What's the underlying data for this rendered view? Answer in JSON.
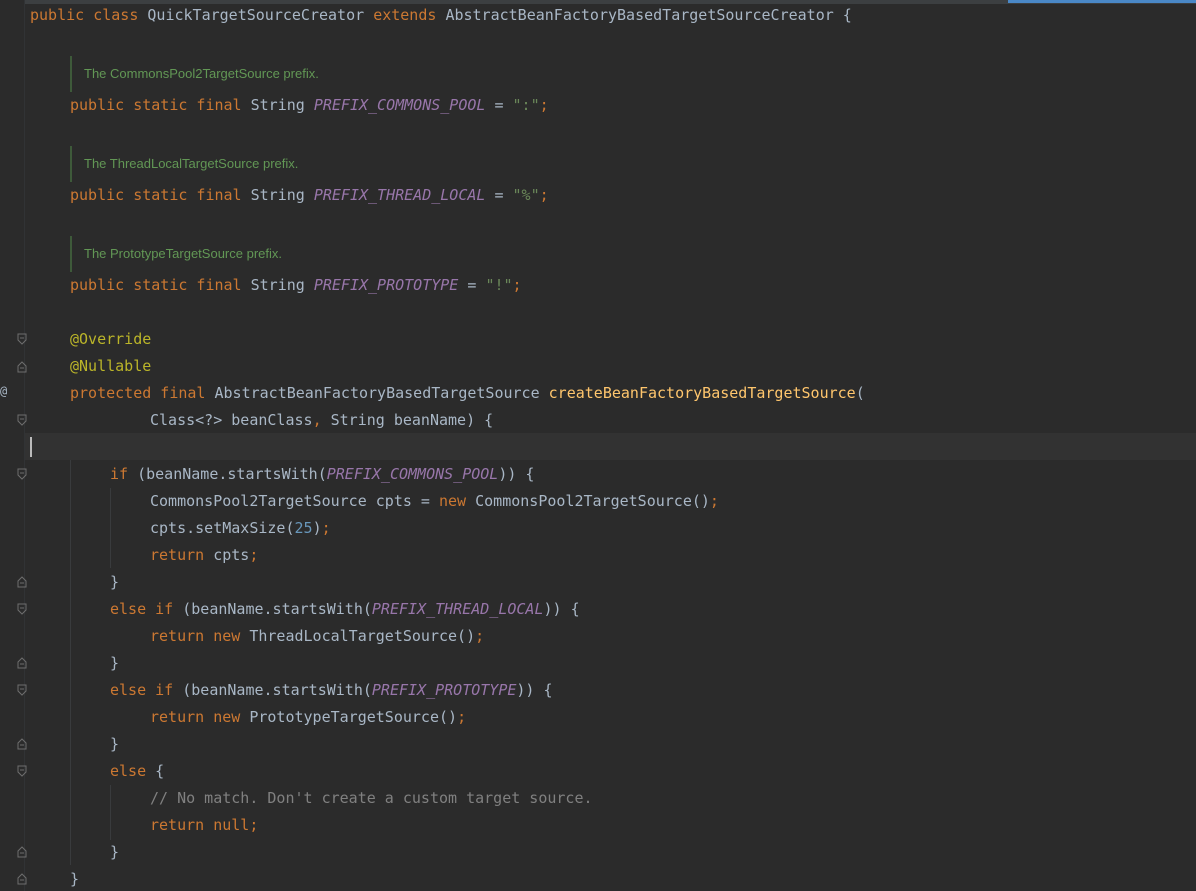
{
  "editor": {
    "annotation_gutter_glyph": "@",
    "lines": [
      {
        "id": "class-decl",
        "tokens": [
          {
            "t": "public class ",
            "c": "kw"
          },
          {
            "t": "QuickTargetSourceCreator ",
            "c": "plain"
          },
          {
            "t": "extends ",
            "c": "kw"
          },
          {
            "t": "AbstractBeanFactoryBasedTargetSourceCreator {",
            "c": "plain"
          }
        ]
      },
      {
        "id": "field-commons-pool",
        "tokens": [
          {
            "t": "public static final ",
            "c": "kw"
          },
          {
            "t": "String ",
            "c": "plain"
          },
          {
            "t": "PREFIX_COMMONS_POOL",
            "c": "const"
          },
          {
            "t": " = ",
            "c": "plain"
          },
          {
            "t": "\":\"",
            "c": "str"
          },
          {
            "t": ";",
            "c": "kw"
          }
        ]
      },
      {
        "id": "field-thread-local",
        "tokens": [
          {
            "t": "public static final ",
            "c": "kw"
          },
          {
            "t": "String ",
            "c": "plain"
          },
          {
            "t": "PREFIX_THREAD_LOCAL",
            "c": "const"
          },
          {
            "t": " = ",
            "c": "plain"
          },
          {
            "t": "\"%\"",
            "c": "str"
          },
          {
            "t": ";",
            "c": "kw"
          }
        ]
      },
      {
        "id": "field-prototype",
        "tokens": [
          {
            "t": "public static final ",
            "c": "kw"
          },
          {
            "t": "String ",
            "c": "plain"
          },
          {
            "t": "PREFIX_PROTOTYPE",
            "c": "const"
          },
          {
            "t": " = ",
            "c": "plain"
          },
          {
            "t": "\"!\"",
            "c": "str"
          },
          {
            "t": ";",
            "c": "kw"
          }
        ]
      },
      {
        "id": "override",
        "tokens": [
          {
            "t": "@Override",
            "c": "ann"
          }
        ]
      },
      {
        "id": "nullable",
        "tokens": [
          {
            "t": "@Nullable",
            "c": "ann"
          }
        ]
      },
      {
        "id": "method-sig",
        "tokens": [
          {
            "t": "protected final ",
            "c": "kw"
          },
          {
            "t": "AbstractBeanFactoryBasedTargetSource ",
            "c": "plain"
          },
          {
            "t": "createBeanFactoryBasedTargetSource",
            "c": "fn"
          },
          {
            "t": "(",
            "c": "plain"
          }
        ]
      },
      {
        "id": "method-params",
        "tokens": [
          {
            "t": "Class<?> beanClass",
            "c": "plain"
          },
          {
            "t": ", ",
            "c": "kw"
          },
          {
            "t": "String beanName) {",
            "c": "plain"
          }
        ]
      },
      {
        "id": "if-commons",
        "tokens": [
          {
            "t": "if ",
            "c": "kw"
          },
          {
            "t": "(beanName.startsWith(",
            "c": "plain"
          },
          {
            "t": "PREFIX_COMMONS_POOL",
            "c": "const"
          },
          {
            "t": ")) {",
            "c": "plain"
          }
        ]
      },
      {
        "id": "new-cpts",
        "tokens": [
          {
            "t": "CommonsPool2TargetSource cpts = ",
            "c": "plain"
          },
          {
            "t": "new ",
            "c": "kw"
          },
          {
            "t": "CommonsPool2TargetSource()",
            "c": "plain"
          },
          {
            "t": ";",
            "c": "kw"
          }
        ]
      },
      {
        "id": "set-max-size",
        "tokens": [
          {
            "t": "cpts.setMaxSize(",
            "c": "plain"
          },
          {
            "t": "25",
            "c": "num"
          },
          {
            "t": ")",
            "c": "plain"
          },
          {
            "t": ";",
            "c": "kw"
          }
        ]
      },
      {
        "id": "return-cpts",
        "tokens": [
          {
            "t": "return ",
            "c": "kw"
          },
          {
            "t": "cpts",
            "c": "plain"
          },
          {
            "t": ";",
            "c": "kw"
          }
        ]
      },
      {
        "id": "close-1",
        "tokens": [
          {
            "t": "}",
            "c": "plain"
          }
        ]
      },
      {
        "id": "elseif-thread",
        "tokens": [
          {
            "t": "else if ",
            "c": "kw"
          },
          {
            "t": "(beanName.startsWith(",
            "c": "plain"
          },
          {
            "t": "PREFIX_THREAD_LOCAL",
            "c": "const"
          },
          {
            "t": ")) {",
            "c": "plain"
          }
        ]
      },
      {
        "id": "return-thread",
        "tokens": [
          {
            "t": "return new ",
            "c": "kw"
          },
          {
            "t": "ThreadLocalTargetSource()",
            "c": "plain"
          },
          {
            "t": ";",
            "c": "kw"
          }
        ]
      },
      {
        "id": "close-2",
        "tokens": [
          {
            "t": "}",
            "c": "plain"
          }
        ]
      },
      {
        "id": "elseif-proto",
        "tokens": [
          {
            "t": "else if ",
            "c": "kw"
          },
          {
            "t": "(beanName.startsWith(",
            "c": "plain"
          },
          {
            "t": "PREFIX_PROTOTYPE",
            "c": "const"
          },
          {
            "t": ")) {",
            "c": "plain"
          }
        ]
      },
      {
        "id": "return-proto",
        "tokens": [
          {
            "t": "return new ",
            "c": "kw"
          },
          {
            "t": "PrototypeTargetSource()",
            "c": "plain"
          },
          {
            "t": ";",
            "c": "kw"
          }
        ]
      },
      {
        "id": "close-3",
        "tokens": [
          {
            "t": "}",
            "c": "plain"
          }
        ]
      },
      {
        "id": "else",
        "tokens": [
          {
            "t": "else ",
            "c": "kw"
          },
          {
            "t": "{",
            "c": "plain"
          }
        ]
      },
      {
        "id": "comment-no-match",
        "tokens": [
          {
            "t": "// No match. Don't create a custom target source.",
            "c": "cmt"
          }
        ]
      },
      {
        "id": "return-null",
        "tokens": [
          {
            "t": "return null",
            "c": "kw"
          },
          {
            "t": ";",
            "c": "kw"
          }
        ]
      },
      {
        "id": "close-4",
        "tokens": [
          {
            "t": "}",
            "c": "plain"
          }
        ]
      },
      {
        "id": "close-method",
        "tokens": [
          {
            "t": "}",
            "c": "plain"
          }
        ]
      }
    ],
    "doc_comments": [
      "The CommonsPool2TargetSource prefix.",
      "The ThreadLocalTargetSource prefix.",
      "The PrototypeTargetSource prefix."
    ]
  }
}
